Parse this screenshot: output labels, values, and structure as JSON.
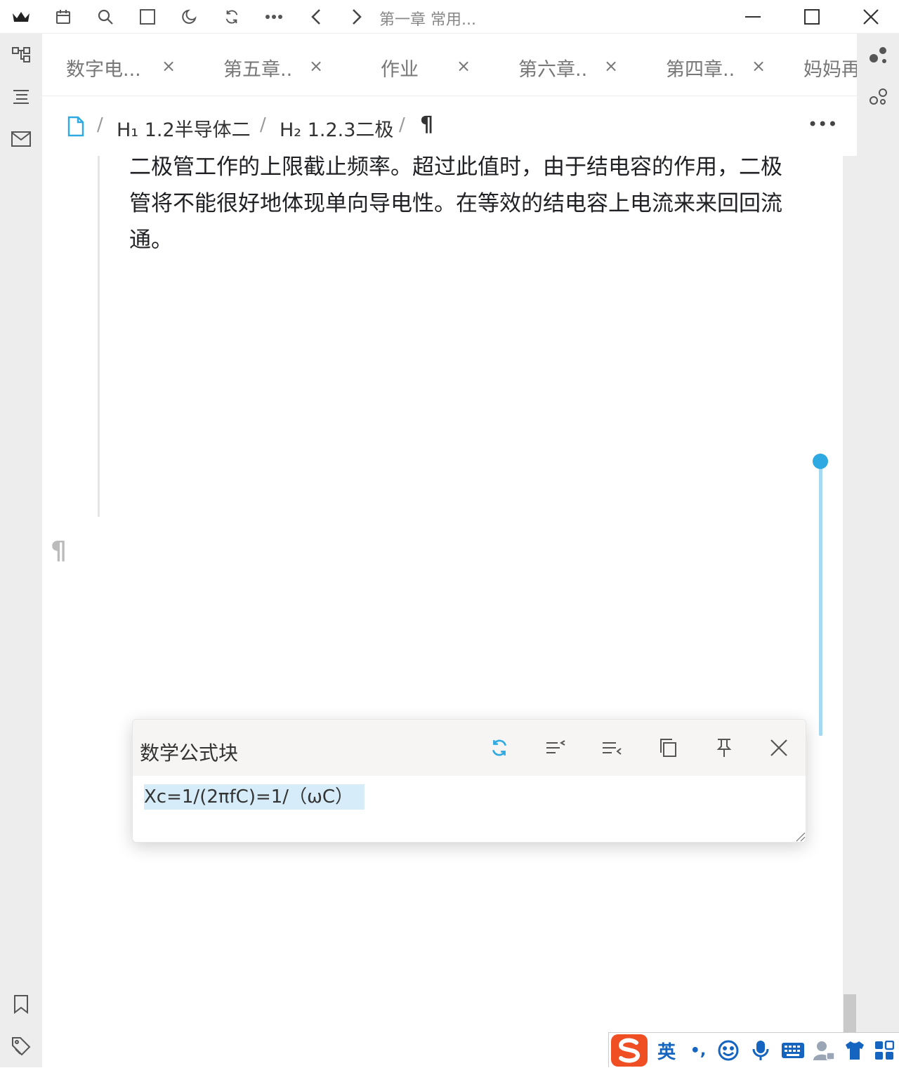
{
  "titlebar": {
    "doc_title": "第一章 常用...",
    "icons": [
      "crown-icon",
      "calendar-icon",
      "search-icon",
      "square-icon",
      "moon-icon",
      "sync-icon",
      "more-icon",
      "back-icon",
      "forward-icon",
      "minimize-icon",
      "maximize-icon",
      "close-icon"
    ]
  },
  "tabs": [
    {
      "label": "数字电...",
      "close": "×"
    },
    {
      "label": "第五章..",
      "close": "×"
    },
    {
      "label": "作业",
      "close": "×"
    },
    {
      "label": "第六章..",
      "close": "×"
    },
    {
      "label": "第四章..",
      "close": "×"
    },
    {
      "label": "妈妈再"
    }
  ],
  "breadcrumb": {
    "items": [
      "H₁ 1.2半导体二",
      "H₂ 1.2.3二极",
      "¶"
    ],
    "separator": "/",
    "more": "•••"
  },
  "content": {
    "paragraph_lines": [
      "二极管工作的上限截止频率。超过此值时，由于结电容的作用，二极",
      "管将不能很好地体现单向导电性。在等效的结电容上电流来来回回流",
      "通。"
    ],
    "gutter_pilcrow": "¶"
  },
  "popup": {
    "title": "数学公式块",
    "formula": "Xc=1/(2πfC)=1/（ωC）",
    "icons": [
      "refresh-icon",
      "align-left-icon",
      "align-right-icon",
      "copy-icon",
      "pin-icon",
      "close-icon"
    ]
  },
  "ime": {
    "mode": "英",
    "punct": "•,",
    "icons": [
      "sogou-logo-icon",
      "emoji-icon",
      "mic-icon",
      "keyboard-icon",
      "user-icon",
      "skin-icon",
      "apps-icon"
    ]
  },
  "colors": {
    "accent": "#2ea9e2",
    "dock_bg": "#ededed",
    "selection": "#d6ecf8",
    "sogou": "#f04e23"
  }
}
